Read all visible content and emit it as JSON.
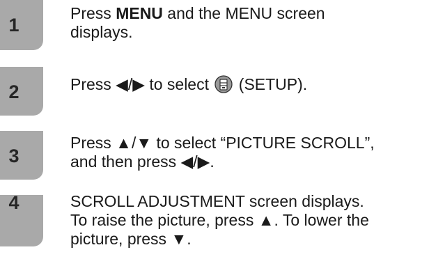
{
  "steps": [
    {
      "number": "1",
      "lines": [
        {
          "pre": "Press ",
          "bold": "MENU",
          "post": " and the MENU screen"
        },
        {
          "text": "displays."
        }
      ]
    },
    {
      "number": "2",
      "pre": "Press ◀/▶ to select ",
      "icon": "setup-icon",
      "post": " (SETUP)."
    },
    {
      "number": "3",
      "lines": [
        {
          "text": "Press ▲/▼ to select “PICTURE SCROLL”,"
        },
        {
          "text": "and then press ◀/▶."
        }
      ]
    },
    {
      "number": "4",
      "lines": [
        {
          "text": "SCROLL ADJUSTMENT screen displays."
        },
        {
          "text": "To raise the picture, press ▲. To lower the"
        },
        {
          "text": "picture, press ▼."
        }
      ]
    }
  ]
}
